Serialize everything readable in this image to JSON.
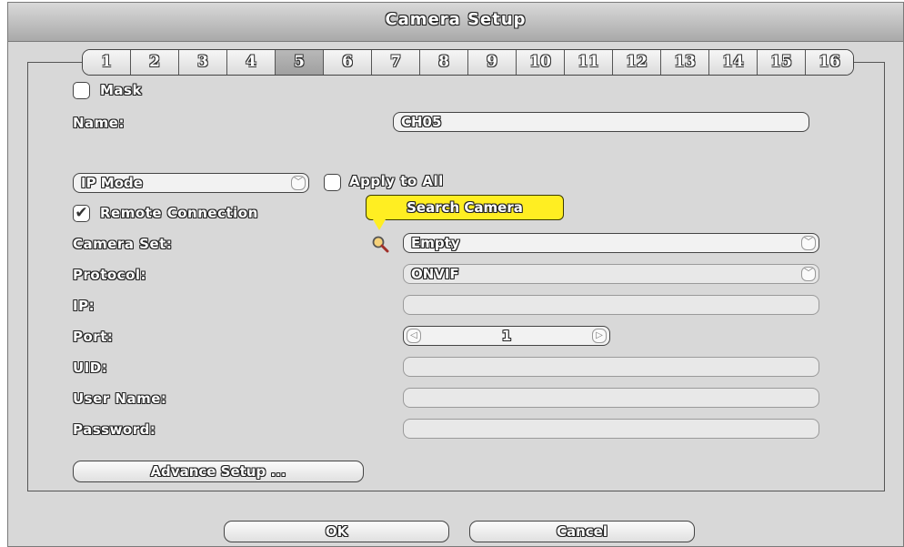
{
  "window": {
    "title": "Camera Setup"
  },
  "tabs": [
    "1",
    "2",
    "3",
    "4",
    "5",
    "6",
    "7",
    "8",
    "9",
    "10",
    "11",
    "12",
    "13",
    "14",
    "15",
    "16"
  ],
  "active_tab": "5",
  "mask": {
    "label": "Mask",
    "checked": false
  },
  "name": {
    "label": "Name:",
    "value": "CH05"
  },
  "mode_select": {
    "value": "IP Mode"
  },
  "apply_all": {
    "label": "Apply to All",
    "checked": false
  },
  "remote": {
    "label": "Remote Connection",
    "checked": true
  },
  "tooltip": {
    "text": "Search Camera"
  },
  "camera_set": {
    "label": "Camera Set:",
    "value": "Empty"
  },
  "protocol": {
    "label": "Protocol:",
    "value": "ONVIF"
  },
  "ip": {
    "label": "IP:",
    "value": ""
  },
  "port": {
    "label": "Port:",
    "value": "1"
  },
  "uid": {
    "label": "UID:",
    "value": ""
  },
  "user_name": {
    "label": "User Name:",
    "value": ""
  },
  "password": {
    "label": "Password:",
    "value": ""
  },
  "buttons": {
    "advance": "Advance Setup ...",
    "ok": "OK",
    "cancel": "Cancel"
  },
  "icons": {
    "checkmark": "✔",
    "dropdown": "﹀",
    "search": "magnifier-icon",
    "step_left": "◁",
    "step_right": "▷"
  }
}
